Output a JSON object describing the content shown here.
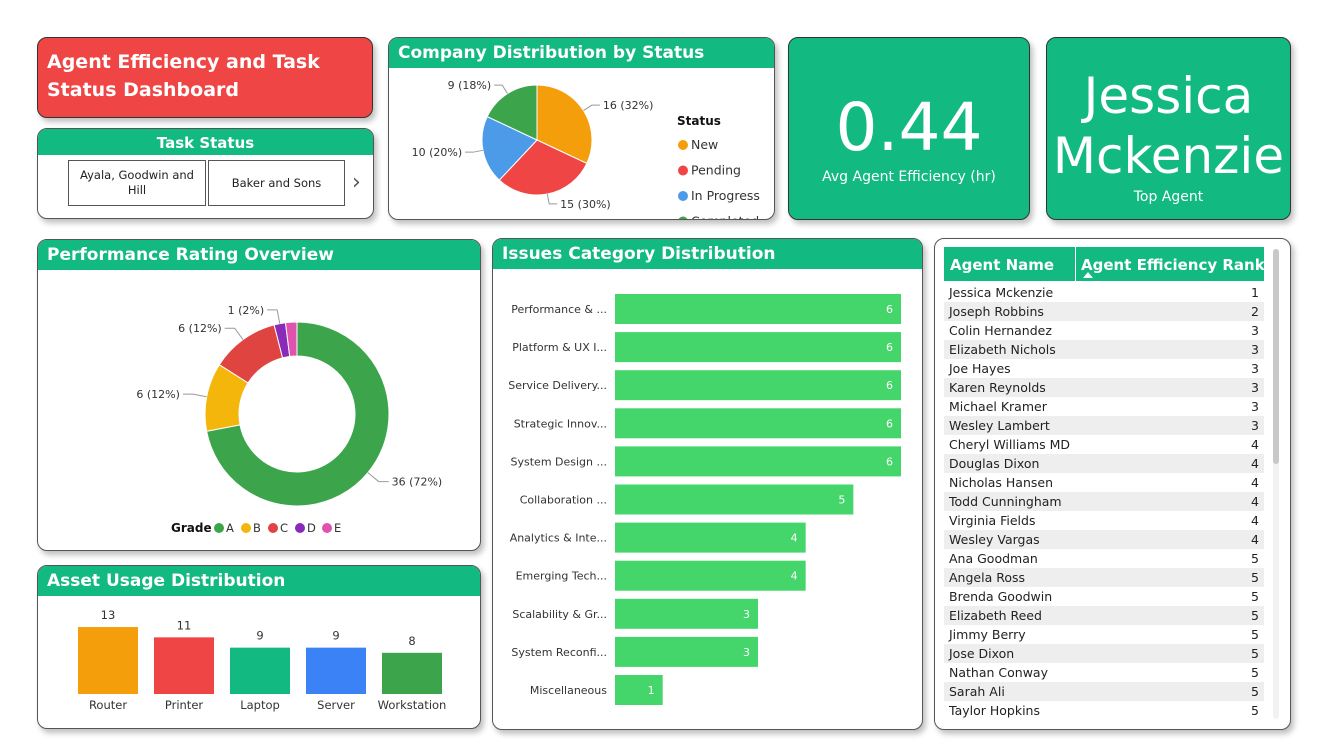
{
  "dashboard": {
    "title": "Agent Efficiency and Task Status Dashboard"
  },
  "colors": {
    "accent": "#12b981",
    "title_bg": "#ef4545",
    "bar": "#44d66a"
  },
  "task_status": {
    "header": "Task Status",
    "items": [
      "Ayala, Goodwin and Hill",
      "Baker and Sons"
    ],
    "next_icon": "chevron-right-icon"
  },
  "company_status": {
    "title": "Company Distribution by Status",
    "legend_title": "Status"
  },
  "kpi": {
    "avg_value": "0.44",
    "avg_label": "Avg Agent Efficiency (hr)",
    "top_agent_first": "Jessica",
    "top_agent_last": "Mckenzie",
    "top_agent_label": "Top Agent"
  },
  "performance": {
    "title": "Performance Rating Overview",
    "legend_title": "Grade"
  },
  "issues": {
    "title": "Issues Category Distribution"
  },
  "assets": {
    "title": "Asset Usage Distribution"
  },
  "agents_table": {
    "columns": [
      "Agent Name",
      "Agent Efficiency Rank"
    ],
    "rows": [
      [
        "Jessica Mckenzie",
        "1"
      ],
      [
        "Joseph Robbins",
        "2"
      ],
      [
        "Colin Hernandez",
        "3"
      ],
      [
        "Elizabeth Nichols",
        "3"
      ],
      [
        "Joe Hayes",
        "3"
      ],
      [
        "Karen Reynolds",
        "3"
      ],
      [
        "Michael Kramer",
        "3"
      ],
      [
        "Wesley Lambert",
        "3"
      ],
      [
        "Cheryl Williams MD",
        "4"
      ],
      [
        "Douglas Dixon",
        "4"
      ],
      [
        "Nicholas Hansen",
        "4"
      ],
      [
        "Todd Cunningham",
        "4"
      ],
      [
        "Virginia Fields",
        "4"
      ],
      [
        "Wesley Vargas",
        "4"
      ],
      [
        "Ana Goodman",
        "5"
      ],
      [
        "Angela Ross",
        "5"
      ],
      [
        "Brenda Goodwin",
        "5"
      ],
      [
        "Elizabeth Reed",
        "5"
      ],
      [
        "Jimmy Berry",
        "5"
      ],
      [
        "Jose Dixon",
        "5"
      ],
      [
        "Nathan Conway",
        "5"
      ],
      [
        "Sarah Ali",
        "5"
      ],
      [
        "Taylor Hopkins",
        "5"
      ]
    ]
  },
  "chart_data": [
    {
      "type": "pie",
      "title": "Company Distribution by Status",
      "legend_title": "Status",
      "labels": [
        "New",
        "Pending",
        "In Progress",
        "Completed"
      ],
      "values": [
        16,
        15,
        10,
        9
      ],
      "percents": [
        "32%",
        "30%",
        "20%",
        "18%"
      ],
      "data_labels": [
        "16 (32%)",
        "15 (30%)",
        "10 (20%)",
        "9 (18%)"
      ],
      "colors": [
        "#f59e0b",
        "#ef4545",
        "#4c9be8",
        "#3ca54c"
      ],
      "legend_position": "right"
    },
    {
      "type": "pie",
      "subtype": "donut",
      "title": "Performance Rating Overview",
      "legend_title": "Grade",
      "labels": [
        "A",
        "B",
        "C",
        "D",
        "E"
      ],
      "values": [
        36,
        6,
        6,
        1,
        1
      ],
      "percents": [
        "72%",
        "12%",
        "12%",
        "2%",
        "2%"
      ],
      "data_labels": [
        "36 (72%)",
        "6 (12%)",
        "6 (12%)",
        "1 (2%)",
        ""
      ],
      "colors": [
        "#3ca54c",
        "#f5b60b",
        "#e04440",
        "#8a2bb8",
        "#e052b0"
      ],
      "legend_position": "bottom"
    },
    {
      "type": "bar",
      "orientation": "horizontal",
      "title": "Issues Category Distribution",
      "categories": [
        "Performance & ...",
        "Platform & UX I...",
        "Service Delivery...",
        "Strategic Innov...",
        "System Design ...",
        "Collaboration ...",
        "Analytics & Inte...",
        "Emerging Tech...",
        "Scalability & Gr...",
        "System Reconfi...",
        "Miscellaneous"
      ],
      "values": [
        6,
        6,
        6,
        6,
        6,
        5,
        4,
        4,
        3,
        3,
        1
      ],
      "xlim": [
        0,
        6
      ],
      "color": "#44d66a"
    },
    {
      "type": "bar",
      "title": "Asset Usage Distribution",
      "categories": [
        "Router",
        "Printer",
        "Laptop",
        "Server",
        "Workstation"
      ],
      "values": [
        13,
        11,
        9,
        9,
        8
      ],
      "colors": [
        "#f59e0b",
        "#ef4545",
        "#12b981",
        "#3b82f6",
        "#3ca54c"
      ]
    }
  ]
}
